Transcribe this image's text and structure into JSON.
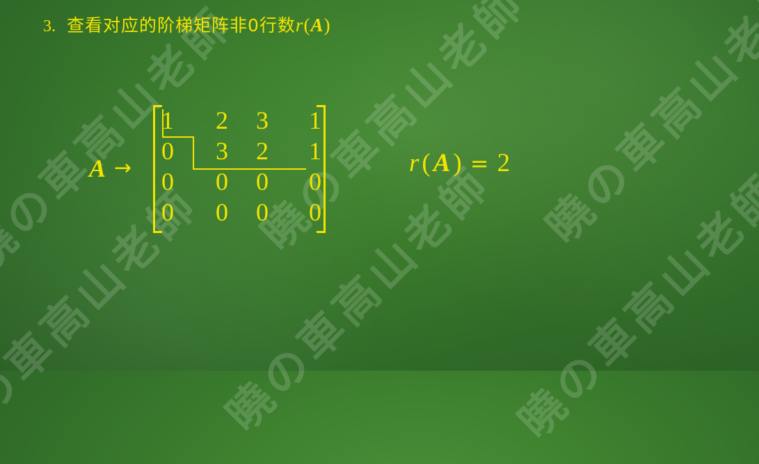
{
  "heading": {
    "number": "3.",
    "text": "查看对应的阶梯矩阵非0行数",
    "math_r": "r",
    "math_A": "A"
  },
  "matrix_equation": {
    "lhs_var": "A",
    "arrow": "→",
    "rows": [
      [
        "1",
        "2",
        "3",
        "1"
      ],
      [
        "0",
        "3",
        "2",
        "1"
      ],
      [
        "0",
        "0",
        "0",
        "0"
      ],
      [
        "0",
        "0",
        "0",
        "0"
      ]
    ]
  },
  "rank": {
    "r": "r",
    "open": "(",
    "A": "A",
    "close": ")",
    "eq": "=",
    "value": "2"
  },
  "watermark": {
    "text": "曉の車高山老師"
  },
  "colors": {
    "chalk_yellow": "#f3e400",
    "board_green": "#3f822f"
  }
}
